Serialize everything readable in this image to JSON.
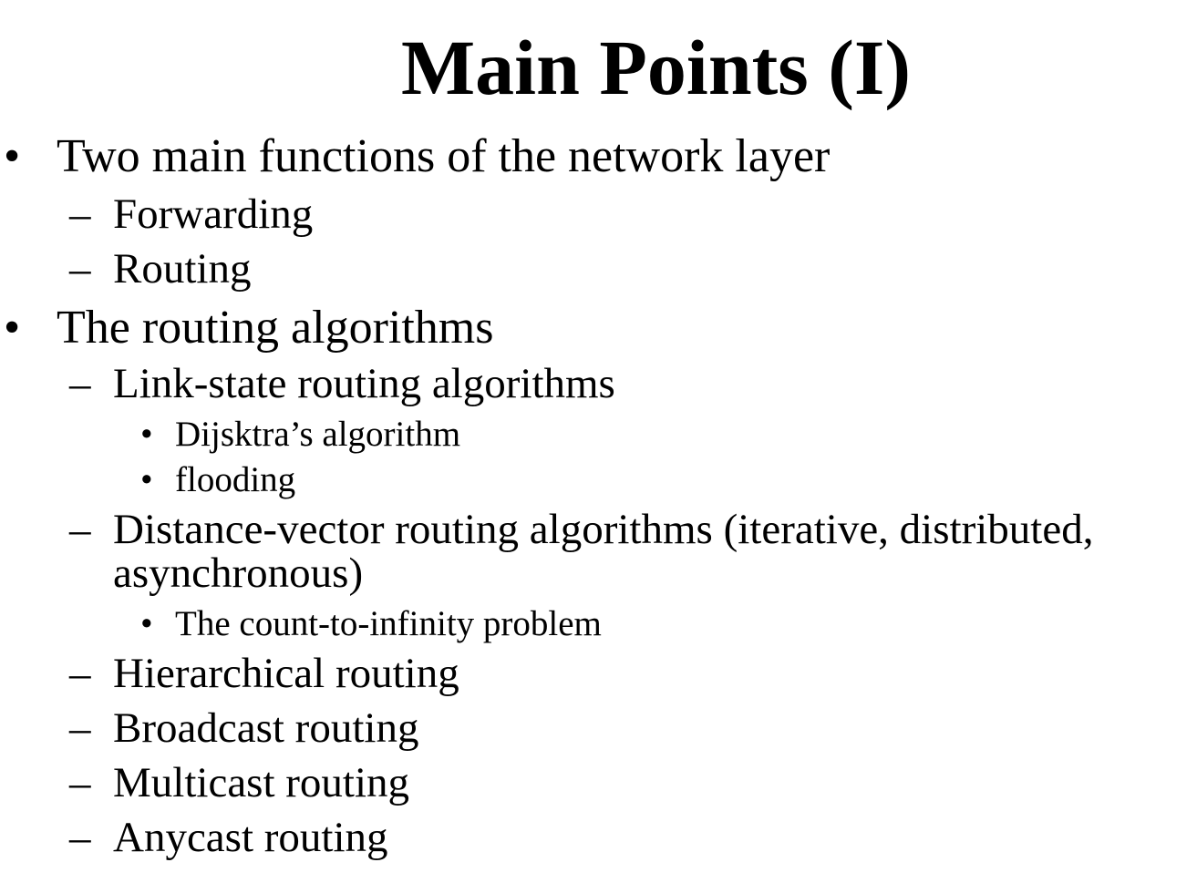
{
  "slide": {
    "title": "Main Points (I)",
    "bullet_marker": "•",
    "dash_marker": "–",
    "subbullet_marker": "•",
    "items": [
      "Two main functions of the network layer",
      "Forwarding",
      "Routing",
      "The routing algorithms",
      "Link-state routing algorithms",
      "Dijsktra’s algorithm",
      "flooding",
      "Distance-vector routing algorithms (iterative, distributed,",
      "asynchronous)",
      "The count-to-infinity problem",
      "Hierarchical routing",
      "Broadcast routing",
      "Multicast routing",
      "Anycast routing"
    ]
  }
}
